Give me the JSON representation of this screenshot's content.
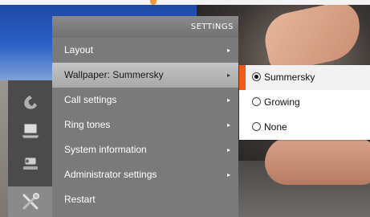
{
  "menu": {
    "header": "SETTINGS",
    "items": [
      {
        "label": "Layout",
        "has_submenu": true,
        "selected": false
      },
      {
        "label": "Wallpaper: Summersky",
        "has_submenu": true,
        "selected": true
      },
      {
        "label": "Call settings",
        "has_submenu": true,
        "selected": false
      },
      {
        "label": "Ring tones",
        "has_submenu": true,
        "selected": false
      },
      {
        "label": "System information",
        "has_submenu": true,
        "selected": false
      },
      {
        "label": "Administrator settings",
        "has_submenu": true,
        "selected": false
      },
      {
        "label": "Restart",
        "has_submenu": false,
        "selected": false
      }
    ],
    "arrow_glyph": "▸"
  },
  "submenu": {
    "options": [
      {
        "label": "Summersky",
        "checked": true
      },
      {
        "label": "Growing",
        "checked": false
      },
      {
        "label": "None",
        "checked": false
      }
    ]
  },
  "dock": {
    "icons": [
      "phone-icon",
      "laptop-icon",
      "video-camera-icon",
      "tools-icon"
    ],
    "active_icon": "tools-icon"
  },
  "colors": {
    "accent": "#f05a1a",
    "menu_bg": "#7a7a7a",
    "selected_item_bg": "#b8b8b8"
  }
}
